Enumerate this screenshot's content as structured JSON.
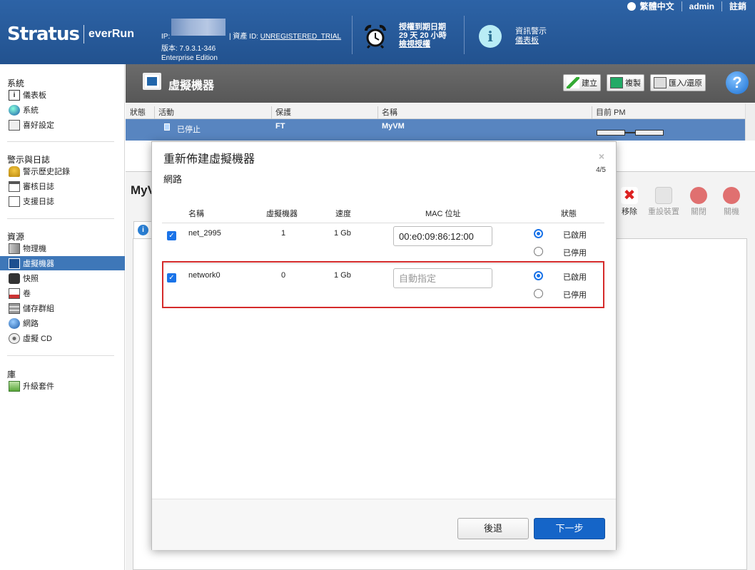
{
  "header": {
    "logo_brand": "Stratus",
    "logo_product": "everRun",
    "language": "繁體中文",
    "user": "admin",
    "logout": "註銷",
    "ip_label": "IP:",
    "asset_label": "| 資產 ID:",
    "asset_value": "UNREGISTERED_TRIAL",
    "version": "版本: 7.9.3.1-346",
    "edition": "Enterprise Edition",
    "license_title": "授權到期日期",
    "license_remaining": "29 天 20 小時",
    "license_link": "檢視授權",
    "alerts_title": "資訊警示",
    "alerts_link": "儀表板"
  },
  "sidebar": {
    "sections": [
      {
        "title": "系統",
        "items": [
          "儀表板",
          "系統",
          "喜好設定"
        ]
      },
      {
        "title": "警示與日誌",
        "items": [
          "警示歷史記錄",
          "審核日誌",
          "支援日誌"
        ]
      },
      {
        "title": "資源",
        "items": [
          "物理機",
          "虛擬機器",
          "快照",
          "卷",
          "儲存群組",
          "網路",
          "虛擬 CD"
        ]
      },
      {
        "title": "庫",
        "items": [
          "升級套件"
        ]
      }
    ],
    "active_item": "虛擬機器"
  },
  "page": {
    "title": "虛擬機器",
    "toolbar": {
      "create": "建立",
      "copy": "複製",
      "import": "匯入/還原"
    },
    "help": "?",
    "grid_headers": [
      "狀態",
      "活動",
      "保護",
      "名稱",
      "目前 PM"
    ],
    "row": {
      "activity": "已停止",
      "protection": "FT",
      "name": "MyVM"
    },
    "details_title": "MyV",
    "actions": [
      "移除",
      "重設裝置",
      "關閉",
      "關機"
    ]
  },
  "modal": {
    "title": "重新佈建虛擬機器",
    "subtitle": "網路",
    "close": "×",
    "step": "4/5",
    "columns": [
      "名稱",
      "虛擬機器",
      "速度",
      "MAC 位址",
      "狀態"
    ],
    "rows": [
      {
        "name": "net_2995",
        "vms": "1",
        "speed": "1 Gb",
        "mac": "00:e0:09:86:12:00",
        "mac_placeholder": "",
        "status_enabled": "已啟用",
        "status_disabled": "已停用",
        "checked": true
      },
      {
        "name": "network0",
        "vms": "0",
        "speed": "1 Gb",
        "mac": "",
        "mac_placeholder": "自動指定",
        "status_enabled": "已啟用",
        "status_disabled": "已停用",
        "checked": true
      }
    ],
    "back": "後退",
    "next": "下一步"
  },
  "colors": {
    "header_blue": "#22528f",
    "selection_blue": "#5885c0",
    "primary_button": "#1565c8",
    "highlight_red": "#d52b2b"
  }
}
